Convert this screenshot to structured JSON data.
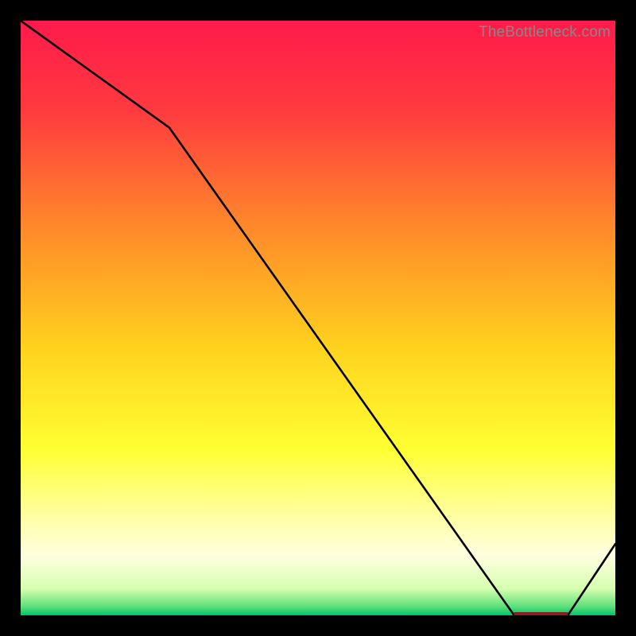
{
  "watermark": "TheBottleneck.com",
  "axis_label": "",
  "chart_data": {
    "type": "line",
    "title": "",
    "xlabel": "",
    "ylabel": "",
    "xlim": [
      0,
      100
    ],
    "ylim": [
      0,
      100
    ],
    "x": [
      0,
      25,
      83,
      92,
      100
    ],
    "values": [
      100,
      82,
      0,
      0,
      12
    ],
    "background_gradient": {
      "stops": [
        {
          "offset": 0.0,
          "color": "#ff1a4b"
        },
        {
          "offset": 0.15,
          "color": "#ff3a3f"
        },
        {
          "offset": 0.35,
          "color": "#ff8a2a"
        },
        {
          "offset": 0.55,
          "color": "#ffd21e"
        },
        {
          "offset": 0.72,
          "color": "#ffff33"
        },
        {
          "offset": 0.84,
          "color": "#ffffaa"
        },
        {
          "offset": 0.9,
          "color": "#ffffe0"
        },
        {
          "offset": 0.955,
          "color": "#d6ffb0"
        },
        {
          "offset": 0.985,
          "color": "#5fe07a"
        },
        {
          "offset": 1.0,
          "color": "#00c46a"
        }
      ]
    },
    "optimal_band": {
      "x_start": 83,
      "x_end": 92,
      "y": 0
    }
  }
}
